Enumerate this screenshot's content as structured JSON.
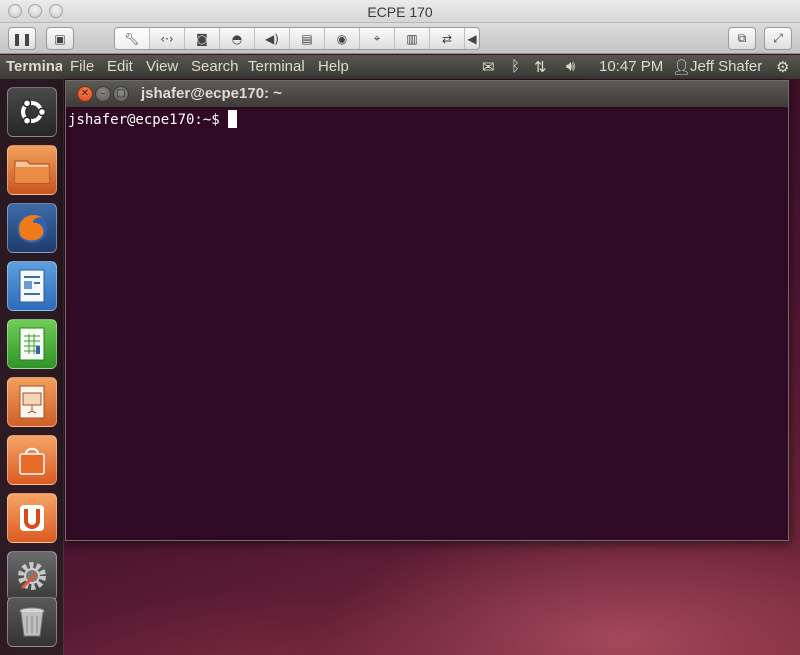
{
  "host_window": {
    "title": "ECPE 170",
    "toolbar_icons": [
      "pause-icon",
      "snapshot-icon",
      "settings-wrench-icon",
      "network-icon",
      "hard-disk-icon",
      "cd-icon",
      "sound-icon",
      "usb-icon",
      "camera-icon",
      "mouse-icon",
      "usb-device-icon",
      "sharing-icon",
      "collapse-arrow-icon",
      "unity-mode-icon",
      "fullscreen-icon"
    ]
  },
  "panel": {
    "app_name": "Terminal",
    "menus": [
      "File",
      "Edit",
      "View",
      "Search",
      "Terminal",
      "Help"
    ],
    "time": "10:47 PM",
    "user": "Jeff Shafer"
  },
  "launcher": {
    "items": [
      "dash-home",
      "files",
      "firefox",
      "libreoffice-writer",
      "libreoffice-calc",
      "libreoffice-impress",
      "ubuntu-software-center",
      "ubuntu-one",
      "system-settings",
      "trash"
    ]
  },
  "terminal": {
    "title": "jshafer@ecpe170: ~",
    "prompt": "jshafer@ecpe170:~$"
  },
  "colors": {
    "terminal_bg": "#300a24",
    "panel_bg": "#3c3b37",
    "close_button": "#e9541b"
  }
}
